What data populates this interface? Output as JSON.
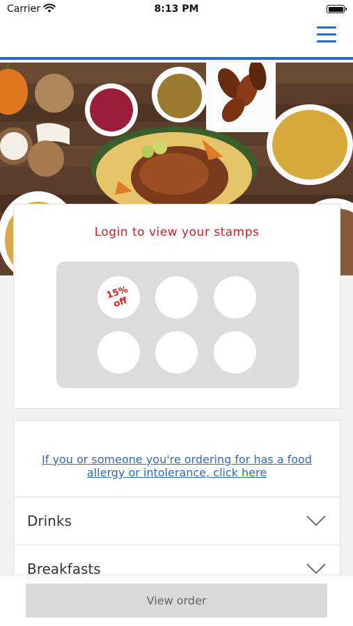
{
  "status_bar": {
    "carrier": "Carrier",
    "time": "8:13 PM"
  },
  "nav": {
    "menu_icon": "hamburger-menu-icon",
    "accent_color": "#2d6bbf"
  },
  "stamp_card": {
    "title": "Login to view your stamps",
    "title_color": "#c8202b",
    "stamps": [
      {
        "label_line1": "15%",
        "label_line2": "off"
      },
      {
        "label_line1": "",
        "label_line2": ""
      },
      {
        "label_line1": "",
        "label_line2": ""
      },
      {
        "label_line1": "",
        "label_line2": ""
      },
      {
        "label_line1": "",
        "label_line2": ""
      },
      {
        "label_line1": "",
        "label_line2": ""
      }
    ]
  },
  "menu": {
    "allergy_link": "If you or someone you're ordering for has a food allergy or intolerance, click here",
    "categories": [
      {
        "label": "Drinks",
        "icon": "chevron-down-icon"
      },
      {
        "label": "Breakfasts",
        "icon": "chevron-down-icon"
      }
    ]
  },
  "footer": {
    "view_order_label": "View order"
  }
}
